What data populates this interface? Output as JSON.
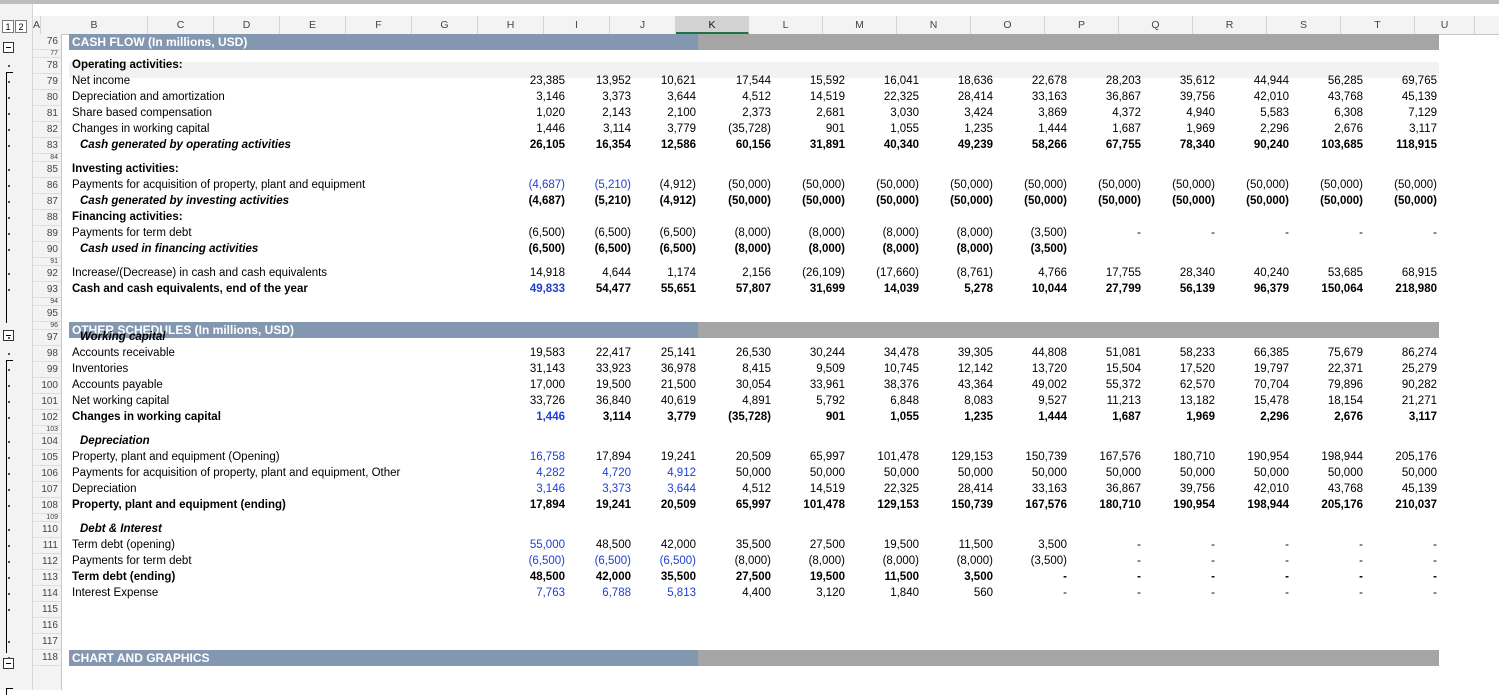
{
  "outline_levels": [
    "1",
    "2"
  ],
  "col_headers": [
    "A",
    "B",
    "C",
    "D",
    "E",
    "F",
    "G",
    "H",
    "I",
    "J",
    "K",
    "L",
    "M",
    "N",
    "O",
    "P",
    "Q",
    "R",
    "S",
    "T",
    "U"
  ],
  "selected_column": "K",
  "row_numbers": [
    "76",
    "77",
    "78",
    "79",
    "80",
    "81",
    "82",
    "83",
    "84",
    "85",
    "86",
    "87",
    "88",
    "89",
    "90",
    "91",
    "92",
    "93",
    "94",
    "95",
    "96",
    "97",
    "98",
    "99",
    "100",
    "101",
    "102",
    "103",
    "104",
    "105",
    "106",
    "107",
    "108",
    "109",
    "110",
    "111",
    "112",
    "113",
    "114",
    "115",
    "116",
    "117",
    "118"
  ],
  "section_titles": {
    "cash_flow": "CASH FLOW (In millions, USD)",
    "other_schedules": "OTHER SCHEDULES  (In millions, USD)",
    "chart": "CHART AND GRAPHICS"
  },
  "colors": {
    "section_header": "#8497b0",
    "section_header_grey": "#a5a5a5",
    "input_blue": "#1f3fd1",
    "selection": "#217346"
  },
  "rows": [
    {
      "r": 78,
      "label": "Operating activities:",
      "style": "b",
      "band": true,
      "values": []
    },
    {
      "r": 79,
      "label": "Net income",
      "values": [
        "23,385",
        "13,952",
        "10,621",
        "17,544",
        "15,592",
        "16,041",
        "18,636",
        "22,678",
        "28,203",
        "35,612",
        "44,944",
        "56,285",
        "69,765"
      ]
    },
    {
      "r": 80,
      "label": "Depreciation and amortization",
      "values": [
        "3,146",
        "3,373",
        "3,644",
        "4,512",
        "14,519",
        "22,325",
        "28,414",
        "33,163",
        "36,867",
        "39,756",
        "42,010",
        "43,768",
        "45,139"
      ]
    },
    {
      "r": 81,
      "label": "Share based compensation",
      "values": [
        "1,020",
        "2,143",
        "2,100",
        "2,373",
        "2,681",
        "3,030",
        "3,424",
        "3,869",
        "4,372",
        "4,940",
        "5,583",
        "6,308",
        "7,129"
      ]
    },
    {
      "r": 82,
      "label": "Changes in working capital",
      "values": [
        "1,446",
        "3,114",
        "3,779",
        "(35,728)",
        "901",
        "1,055",
        "1,235",
        "1,444",
        "1,687",
        "1,969",
        "2,296",
        "2,676",
        "3,117"
      ]
    },
    {
      "r": 83,
      "label": "Cash generated by operating activities",
      "style": "bi",
      "indent": true,
      "values": [
        "26,105",
        "16,354",
        "12,586",
        "60,156",
        "31,891",
        "40,340",
        "49,239",
        "58,266",
        "67,755",
        "78,340",
        "90,240",
        "103,685",
        "118,915"
      ]
    },
    {
      "r": 85,
      "label": "Investing activities:",
      "style": "b",
      "values": []
    },
    {
      "r": 86,
      "label": "Payments for acquisition of property, plant and equipment",
      "blue": [
        0,
        1
      ],
      "values": [
        "(4,687)",
        "(5,210)",
        "(4,912)",
        "(50,000)",
        "(50,000)",
        "(50,000)",
        "(50,000)",
        "(50,000)",
        "(50,000)",
        "(50,000)",
        "(50,000)",
        "(50,000)",
        "(50,000)"
      ]
    },
    {
      "r": 87,
      "label": "Cash generated by  investing activities",
      "style": "bi",
      "indent": true,
      "values": [
        "(4,687)",
        "(5,210)",
        "(4,912)",
        "(50,000)",
        "(50,000)",
        "(50,000)",
        "(50,000)",
        "(50,000)",
        "(50,000)",
        "(50,000)",
        "(50,000)",
        "(50,000)",
        "(50,000)"
      ]
    },
    {
      "r": 88,
      "label": "Financing activities:",
      "style": "b",
      "values": []
    },
    {
      "r": 89,
      "label": "Payments for term debt",
      "values": [
        "(6,500)",
        "(6,500)",
        "(6,500)",
        "(8,000)",
        "(8,000)",
        "(8,000)",
        "(8,000)",
        "(3,500)",
        "-",
        "-",
        "-",
        "-",
        "-"
      ]
    },
    {
      "r": 90,
      "label": "Cash used in financing activities",
      "style": "bi",
      "indent": true,
      "values": [
        "(6,500)",
        "(6,500)",
        "(6,500)",
        "(8,000)",
        "(8,000)",
        "(8,000)",
        "(8,000)",
        "(3,500)",
        "",
        "",
        "",
        "",
        ""
      ]
    },
    {
      "r": 92,
      "label": "Increase/(Decrease) in cash and cash equivalents",
      "values": [
        "14,918",
        "4,644",
        "1,174",
        "2,156",
        "(26,109)",
        "(17,660)",
        "(8,761)",
        "4,766",
        "17,755",
        "28,340",
        "40,240",
        "53,685",
        "68,915"
      ]
    },
    {
      "r": 93,
      "label": "Cash and cash equivalents, end of the year",
      "style": "b",
      "blue": [
        0
      ],
      "values": [
        "49,833",
        "54,477",
        "55,651",
        "57,807",
        "31,699",
        "14,039",
        "5,278",
        "10,044",
        "27,799",
        "56,139",
        "96,379",
        "150,064",
        "218,980"
      ]
    },
    {
      "r": 97,
      "label": "Working capital",
      "style": "bi",
      "indent": true,
      "values": []
    },
    {
      "r": 98,
      "label": "Accounts receivable",
      "values": [
        "19,583",
        "22,417",
        "25,141",
        "26,530",
        "30,244",
        "34,478",
        "39,305",
        "44,808",
        "51,081",
        "58,233",
        "66,385",
        "75,679",
        "86,274"
      ]
    },
    {
      "r": 99,
      "label": "Inventories",
      "values": [
        "31,143",
        "33,923",
        "36,978",
        "8,415",
        "9,509",
        "10,745",
        "12,142",
        "13,720",
        "15,504",
        "17,520",
        "19,797",
        "22,371",
        "25,279"
      ]
    },
    {
      "r": 100,
      "label": "Accounts payable",
      "values": [
        "17,000",
        "19,500",
        "21,500",
        "30,054",
        "33,961",
        "38,376",
        "43,364",
        "49,002",
        "55,372",
        "62,570",
        "70,704",
        "79,896",
        "90,282"
      ]
    },
    {
      "r": 101,
      "label": "Net working capital",
      "values": [
        "33,726",
        "36,840",
        "40,619",
        "4,891",
        "5,792",
        "6,848",
        "8,083",
        "9,527",
        "11,213",
        "13,182",
        "15,478",
        "18,154",
        "21,271"
      ]
    },
    {
      "r": 102,
      "label": "Changes in working capital",
      "style": "b",
      "blue": [
        0
      ],
      "values": [
        "1,446",
        "3,114",
        "3,779",
        "(35,728)",
        "901",
        "1,055",
        "1,235",
        "1,444",
        "1,687",
        "1,969",
        "2,296",
        "2,676",
        "3,117"
      ]
    },
    {
      "r": 104,
      "label": "Depreciation",
      "style": "bi",
      "indent": true,
      "values": []
    },
    {
      "r": 105,
      "label": "Property, plant and equipment (Opening)",
      "blue": [
        0
      ],
      "values": [
        "16,758",
        "17,894",
        "19,241",
        "20,509",
        "65,997",
        "101,478",
        "129,153",
        "150,739",
        "167,576",
        "180,710",
        "190,954",
        "198,944",
        "205,176"
      ]
    },
    {
      "r": 106,
      "label": "Payments for acquisition of property, plant and equipment, Other",
      "blue": [
        0,
        1,
        2
      ],
      "values": [
        "4,282",
        "4,720",
        "4,912",
        "50,000",
        "50,000",
        "50,000",
        "50,000",
        "50,000",
        "50,000",
        "50,000",
        "50,000",
        "50,000",
        "50,000"
      ]
    },
    {
      "r": 107,
      "label": "Depreciation",
      "blue": [
        0,
        1,
        2
      ],
      "values": [
        "3,146",
        "3,373",
        "3,644",
        "4,512",
        "14,519",
        "22,325",
        "28,414",
        "33,163",
        "36,867",
        "39,756",
        "42,010",
        "43,768",
        "45,139"
      ]
    },
    {
      "r": 108,
      "label": "Property, plant and equipment (ending)",
      "style": "b",
      "values": [
        "17,894",
        "19,241",
        "20,509",
        "65,997",
        "101,478",
        "129,153",
        "150,739",
        "167,576",
        "180,710",
        "190,954",
        "198,944",
        "205,176",
        "210,037"
      ]
    },
    {
      "r": 110,
      "label": "Debt & Interest",
      "style": "bi",
      "indent": true,
      "values": []
    },
    {
      "r": 111,
      "label": "Term debt (opening)",
      "blue": [
        0
      ],
      "values": [
        "55,000",
        "48,500",
        "42,000",
        "35,500",
        "27,500",
        "19,500",
        "11,500",
        "3,500",
        "-",
        "-",
        "-",
        "-",
        "-"
      ]
    },
    {
      "r": 112,
      "label": "Payments for term debt",
      "blue": [
        0,
        1,
        2
      ],
      "values": [
        "(6,500)",
        "(6,500)",
        "(6,500)",
        "(8,000)",
        "(8,000)",
        "(8,000)",
        "(8,000)",
        "(3,500)",
        "-",
        "-",
        "-",
        "-",
        "-"
      ]
    },
    {
      "r": 113,
      "label": "Term debt (ending)",
      "style": "b",
      "values": [
        "48,500",
        "42,000",
        "35,500",
        "27,500",
        "19,500",
        "11,500",
        "3,500",
        "-",
        "-",
        "-",
        "-",
        "-",
        "-"
      ]
    },
    {
      "r": 114,
      "label": "Interest Expense",
      "blue": [
        0,
        1,
        2
      ],
      "values": [
        "7,763",
        "6,788",
        "5,813",
        "4,400",
        "3,120",
        "1,840",
        "560",
        "-",
        "-",
        "-",
        "-",
        "-",
        "-"
      ]
    }
  ]
}
